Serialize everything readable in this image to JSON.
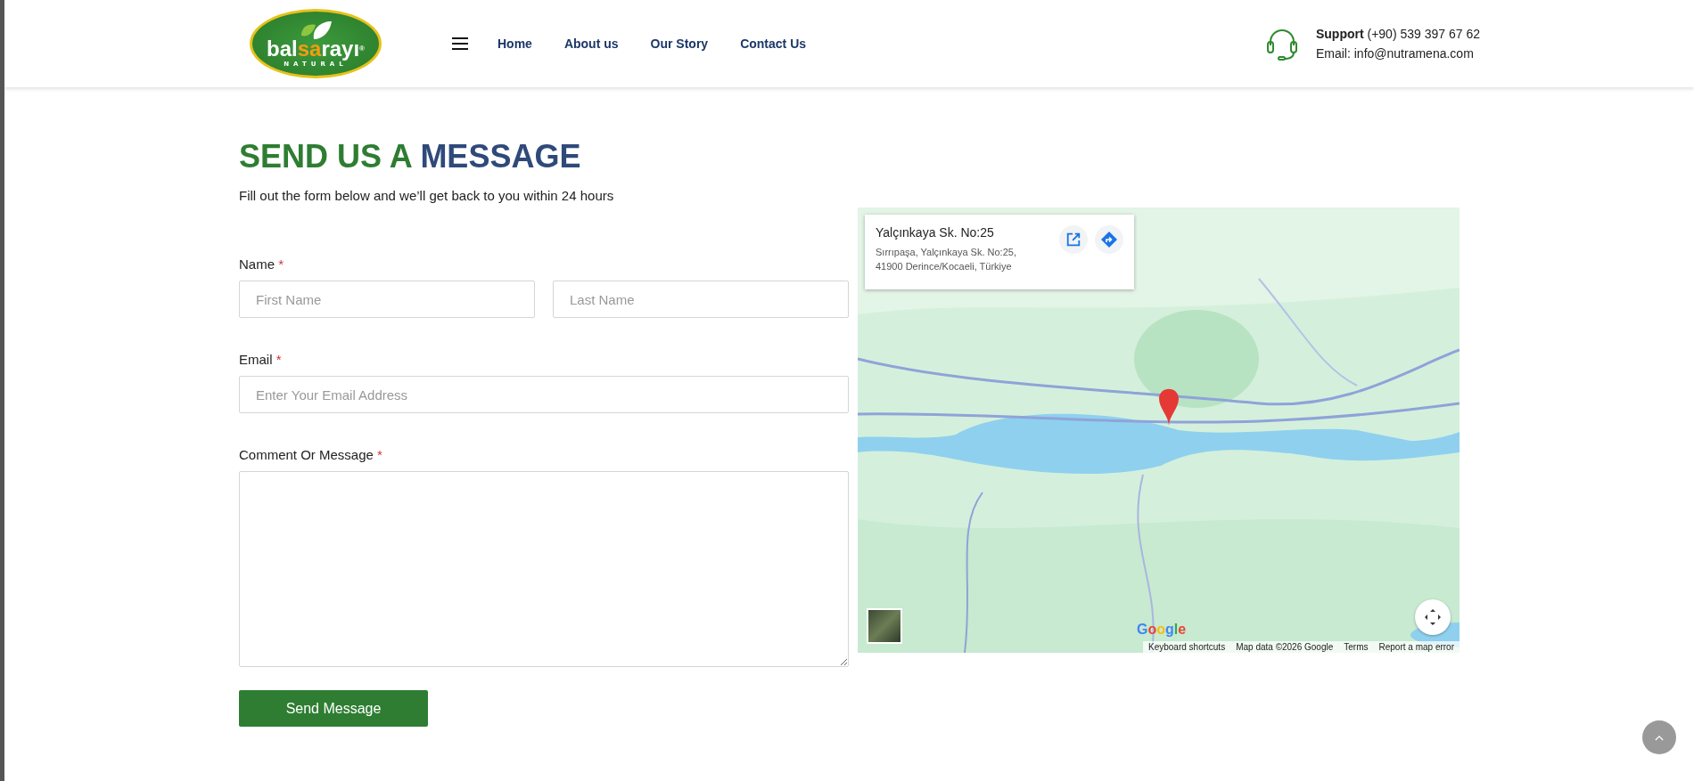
{
  "header": {
    "logo": {
      "wordmark": [
        "bal",
        "sa",
        "rayı"
      ],
      "registered": "®",
      "tagline": "NATURAL"
    },
    "nav": [
      {
        "label": "Home"
      },
      {
        "label": "About us"
      },
      {
        "label": "Our Story"
      },
      {
        "label": "Contact Us"
      }
    ],
    "support": {
      "label": "Support",
      "phone": "(+90) 539 397 67 62",
      "email": "Email: info@nutramena.com"
    }
  },
  "form": {
    "title_first": "SEND US A",
    "title_second": "MESSAGE",
    "subtitle": "Fill out the form below and we’ll get back to you within 24 hours",
    "name": {
      "label": "Name",
      "required": "*",
      "first_placeholder": "First Name",
      "last_placeholder": "Last Name"
    },
    "email": {
      "label": "Email",
      "required": "*",
      "placeholder": "Enter Your Email Address"
    },
    "message": {
      "label": "Comment Or Message",
      "required": "*"
    },
    "submit": "Send Message"
  },
  "map": {
    "kind": "picture",
    "place": {
      "title": "Yalçınkaya Sk. No:25",
      "address_line1": "Sırrıpaşa, Yalçınkaya Sk. No:25,",
      "address_line2": "41900 Derince/Kocaeli, Türkiye"
    },
    "brand": "Google",
    "footer": [
      "Keyboard shortcuts",
      "Map data ©2026 Google",
      "Terms",
      "Report a map error"
    ]
  }
}
